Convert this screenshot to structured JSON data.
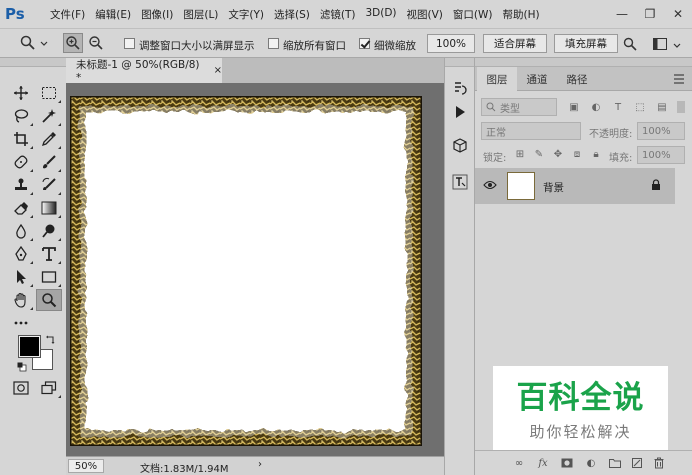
{
  "app": {
    "logo": "Ps"
  },
  "menubar": {
    "items": [
      "文件(F)",
      "编辑(E)",
      "图像(I)",
      "图层(L)",
      "文字(Y)",
      "选择(S)",
      "滤镜(T)",
      "3D(D)",
      "视图(V)",
      "窗口(W)",
      "帮助(H)"
    ]
  },
  "window_controls": {
    "minimize": "—",
    "restore": "❐",
    "close": "✕"
  },
  "options_bar": {
    "resize_windows_label": "调整窗口大小以满屏显示",
    "resize_windows_checked": false,
    "zoom_all_label": "缩放所有窗口",
    "zoom_all_checked": false,
    "scrubby_zoom_label": "细微缩放",
    "scrubby_zoom_checked": true,
    "zoom_value": "100%",
    "fit_screen_label": "适合屏幕",
    "fill_screen_label": "填充屏幕"
  },
  "document": {
    "tab_title": "未标题-1 @ 50%(RGB/8) *",
    "tab_close": "×",
    "status_zoom": "50%",
    "status_info": "文档:1.83M/1.94M",
    "status_arrow": "›"
  },
  "layers_panel": {
    "tabs": [
      "图层",
      "通道",
      "路径"
    ],
    "active_tab": "图层",
    "filter_placeholder": "类型",
    "blend_mode": "正常",
    "opacity_label": "不透明度:",
    "opacity_value": "100%",
    "lock_label": "锁定:",
    "fill_label": "填充:",
    "fill_value": "100%",
    "layers": [
      {
        "name": "背景",
        "visible": true,
        "locked": true
      }
    ]
  },
  "watermark": {
    "title": "百科全说",
    "subtitle": "助你轻松解决"
  },
  "colors": {
    "foreground": "#000000",
    "background": "#ffffff",
    "accent_logo": "#1b5ea8",
    "watermark_green": "#1aa34a",
    "frame_gold": "#b8963a"
  }
}
